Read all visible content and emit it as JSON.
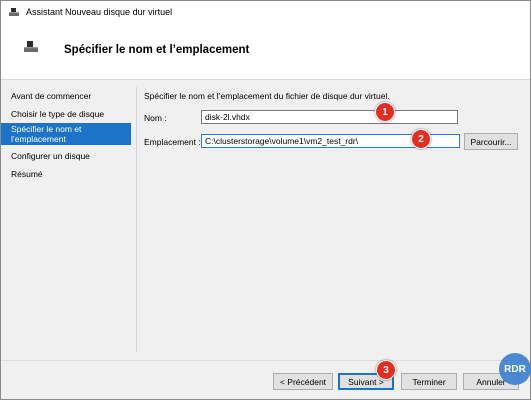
{
  "window": {
    "title": "Assistant Nouveau disque dur virtuel",
    "page_title": "Spécifier le nom et l’emplacement"
  },
  "sidebar": {
    "items": [
      {
        "label": "Avant de commencer",
        "active": false
      },
      {
        "label": "Choisir le type de disque",
        "active": false
      },
      {
        "label": "Spécifier le nom et l’emplacement",
        "active": true
      },
      {
        "label": "Configurer un disque",
        "active": false
      },
      {
        "label": "Résumé",
        "active": false
      }
    ]
  },
  "main": {
    "instruction": "Spécifier le nom et l’emplacement du fichier de disque dur virtuel.",
    "name_label": "Nom :",
    "name_value": "disk-2l.vhdx",
    "location_label": "Emplacement :",
    "location_value": "C:\\clusterstorage\\volume1\\vm2_test_rdr\\",
    "browse_label": "Parcourir..."
  },
  "footer": {
    "prev_label": "< Précédent",
    "next_label": "Suivant >",
    "finish_label": "Terminer",
    "cancel_label": "Annuler"
  },
  "annotations": {
    "badge1": "1",
    "badge2": "2",
    "badge3": "3"
  },
  "watermark": "RDR",
  "colors": {
    "accent": "#1c74c8",
    "badge": "#e32d20"
  },
  "icons": {
    "title": "hard-disk-icon",
    "header": "hard-disk-icon"
  }
}
